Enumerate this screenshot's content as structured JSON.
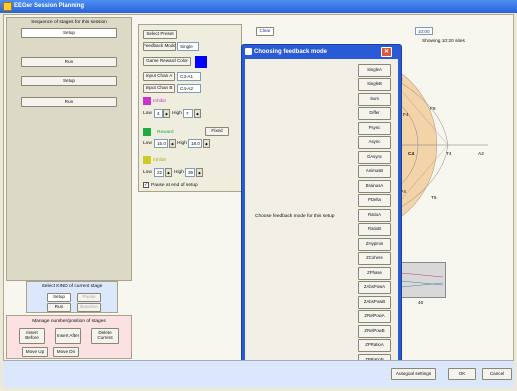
{
  "window": {
    "title": "EEGer Session Planning"
  },
  "sequence": {
    "header": "Sequence of stages for this session",
    "stages": [
      "Setup",
      "Run",
      "Setup",
      "Run"
    ]
  },
  "kind": {
    "header": "Select KIND of current stage",
    "setup_label": "Setup",
    "pause_label": "Pause",
    "run_label": "Run",
    "baseline_label": "Baseline"
  },
  "manage": {
    "header": "Manage number/position of stages",
    "insert_before": "Insert Before",
    "insert_after": "Insert After",
    "delete_current": "Delete Current",
    "move_up": "Move Up",
    "move_dn": "Move Dn"
  },
  "config": {
    "select_preset": "Select Preset",
    "feedback_mode_label": "Feedback Mode",
    "feedback_mode_value": "Single",
    "game_reward_color": "Game Reward Color",
    "input_a_label": "Input Chan A",
    "input_a_value": "C3-A1",
    "input_b_label": "Input Chan B",
    "input_b_value": "C4-A2",
    "inhibit1": {
      "label": "Inhibit",
      "low_label": "Low",
      "low_value": "4",
      "high_label": "High",
      "high_value": "7"
    },
    "reward": {
      "label": "Reward",
      "mode": "Fixed",
      "low_label": "Low",
      "low_value": "15.0",
      "high_label": "High",
      "high_value": "18.0"
    },
    "inhibit2": {
      "label": "Inhibit",
      "low_label": "Low",
      "low_value": "22",
      "high_label": "High",
      "high_value": "36"
    },
    "pause_checkbox": "Pause at end of setup",
    "colors": {
      "reward": "#0000ff",
      "inhibit1": "#cc33cc",
      "reward_swatch": "#22aa44",
      "inhibit2": "#cccc22"
    }
  },
  "topbar": {
    "clear_label": "Clear",
    "time_value": "10:00",
    "showing_text": "Showing 10:20 sites"
  },
  "head_map": {
    "sites": [
      "F3",
      "F8",
      "F4",
      "C4",
      "T4",
      "A2",
      "P4",
      "T6",
      "T2"
    ]
  },
  "dialog": {
    "title": "Choosing feedback mode",
    "prompt": "Choose feedback mode for this setup",
    "modes": [
      "SingleA",
      "SingleB",
      "Sum",
      "Differ",
      "Psync",
      "Async",
      "GAsync",
      "AnimusB",
      "BrainusA",
      "PDelta",
      "RatioA",
      "RatioB",
      "ZHypmin",
      "ZCohere",
      "ZPhase",
      "ZAbsPowA",
      "ZAbsPowB",
      "ZRelPowA",
      "ZRelPowB",
      "ZPRatioA",
      "ZPRatioB"
    ]
  },
  "bottom": {
    "autogoal_label": "Autogoal settings",
    "ok_label": "OK",
    "cancel_label": "Cancel"
  },
  "mini_plot": {
    "axis_label": "40"
  }
}
